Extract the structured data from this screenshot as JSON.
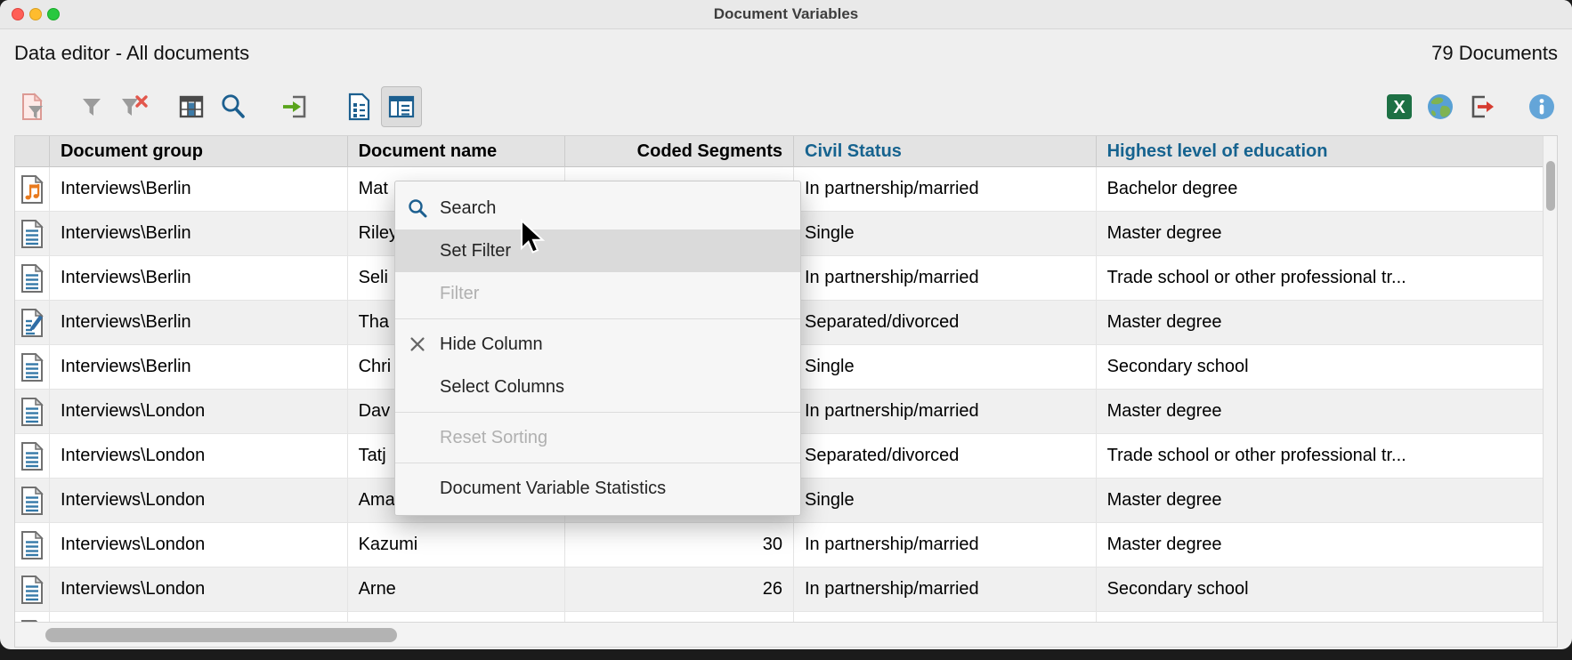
{
  "window": {
    "title": "Document Variables",
    "traffic_lights": [
      "close",
      "minimize",
      "zoom"
    ]
  },
  "header": {
    "title": "Data editor - All documents",
    "document_count": "79 Documents"
  },
  "toolbar": {
    "left_icons": [
      "filter-document",
      "set-filter",
      "remove-all-filters",
      "column-grid",
      "search",
      "insert-data",
      "variable-list-document",
      "data-editor-panel"
    ],
    "active_icon": "data-editor-panel",
    "right_icons": [
      "excel-export",
      "web-export-globe",
      "export-arrow",
      "info"
    ]
  },
  "table": {
    "accent_header_color": "#16638f",
    "columns": [
      {
        "id": "doc_icon",
        "label": ""
      },
      {
        "id": "group",
        "label": "Document group"
      },
      {
        "id": "name",
        "label": "Document name"
      },
      {
        "id": "coded",
        "label": "Coded Segments"
      },
      {
        "id": "civil",
        "label": "Civil Status"
      },
      {
        "id": "education",
        "label": "Highest level of education"
      }
    ],
    "rows": [
      {
        "icon": "audio-document",
        "group": "Interviews\\Berlin",
        "name": "Mat",
        "coded_segments": "",
        "civil_status": "In partnership/married",
        "education": "Bachelor degree"
      },
      {
        "icon": "text-document",
        "group": "Interviews\\Berlin",
        "name": "Riley",
        "coded_segments": "",
        "civil_status": "Single",
        "education": "Master degree"
      },
      {
        "icon": "text-document",
        "group": "Interviews\\Berlin",
        "name": "Seli",
        "coded_segments": "",
        "civil_status": "In partnership/married",
        "education": "Trade school or other professional tr..."
      },
      {
        "icon": "edited-document",
        "group": "Interviews\\Berlin",
        "name": "Tha",
        "coded_segments": "",
        "civil_status": "Separated/divorced",
        "education": "Master degree"
      },
      {
        "icon": "text-document",
        "group": "Interviews\\Berlin",
        "name": "Chri",
        "coded_segments": "",
        "civil_status": "Single",
        "education": "Secondary school"
      },
      {
        "icon": "text-document",
        "group": "Interviews\\London",
        "name": "Dav",
        "coded_segments": "",
        "civil_status": "In partnership/married",
        "education": "Master degree"
      },
      {
        "icon": "text-document",
        "group": "Interviews\\London",
        "name": "Tatj",
        "coded_segments": "",
        "civil_status": "Separated/divorced",
        "education": "Trade school or other professional tr..."
      },
      {
        "icon": "text-document",
        "group": "Interviews\\London",
        "name": "Ama",
        "coded_segments": "",
        "civil_status": "Single",
        "education": "Master degree"
      },
      {
        "icon": "text-document",
        "group": "Interviews\\London",
        "name": "Kazumi",
        "coded_segments": "30",
        "civil_status": "In partnership/married",
        "education": "Master degree"
      },
      {
        "icon": "text-document",
        "group": "Interviews\\London",
        "name": "Arne",
        "coded_segments": "26",
        "civil_status": "In partnership/married",
        "education": "Secondary school"
      }
    ],
    "partial_row": {
      "icon": "text-document"
    }
  },
  "context_menu": {
    "items": [
      {
        "type": "item",
        "label": "Search",
        "icon": "search"
      },
      {
        "type": "item",
        "label": "Set Filter",
        "highlighted": true
      },
      {
        "type": "item",
        "label": "Filter",
        "disabled": true
      },
      {
        "type": "separator"
      },
      {
        "type": "item",
        "label": "Hide Column",
        "icon": "close"
      },
      {
        "type": "item",
        "label": "Select Columns"
      },
      {
        "type": "separator"
      },
      {
        "type": "item",
        "label": "Reset Sorting",
        "disabled": true
      },
      {
        "type": "separator"
      },
      {
        "type": "item",
        "label": "Document Variable Statistics"
      }
    ]
  }
}
